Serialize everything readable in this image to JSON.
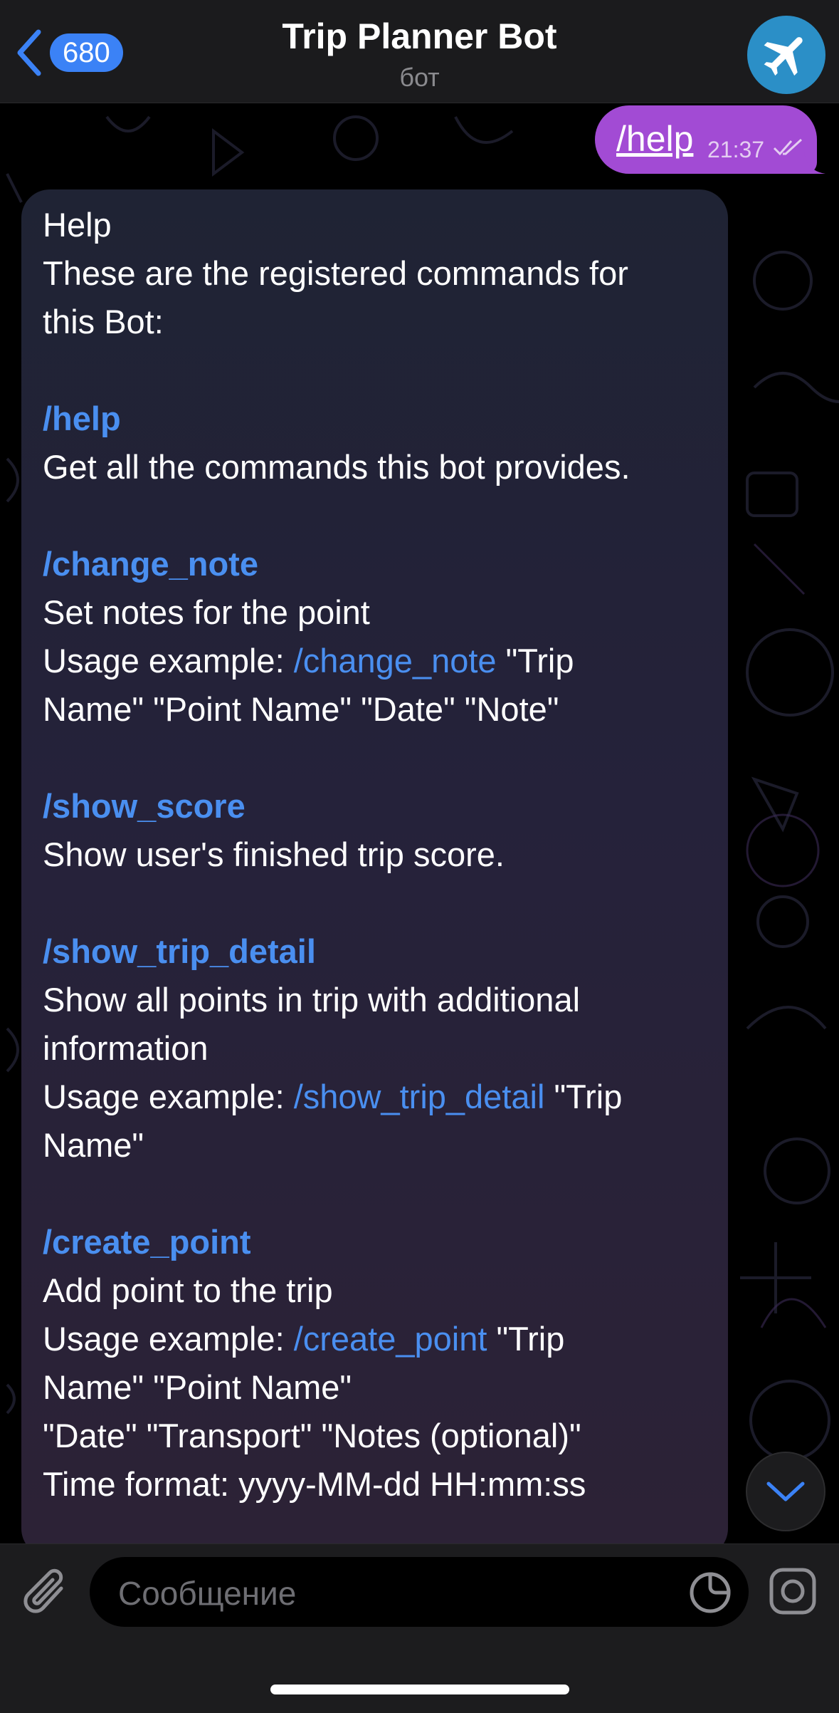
{
  "header": {
    "back_count": "680",
    "title": "Trip Planner Bot",
    "subtitle": "бот"
  },
  "outgoing": {
    "text": "/help",
    "time": "21:37",
    "accent": "#a24bd4"
  },
  "incoming": {
    "lines": {
      "l1": "Help",
      "l2": "These are the registered commands for",
      "l3": "this Bot:",
      "c1": "/help",
      "c1d": "Get all the commands this bot provides.",
      "c2": "/change_note",
      "c2d": "Set notes for the point",
      "c2u_prefix": "Usage example: ",
      "c2u_link": "/change_note",
      "c2u_suffix": " \"Trip",
      "c2u2": "Name\" \"Point Name\" \"Date\" \"Note\"",
      "c3": "/show_score",
      "c3d": "Show user's finished trip score.",
      "c4": "/show_trip_detail",
      "c4d1": "Show all points in trip with additional",
      "c4d2": "information",
      "c4u_prefix": "Usage example: ",
      "c4u_link": "/show_trip_detail",
      "c4u_suffix": " \"Trip",
      "c4u2": "Name\"",
      "c5": "/create_point",
      "c5d": "Add point to the trip",
      "c5u_prefix": "Usage example: ",
      "c5u_link": "/create_point",
      "c5u_suffix": " \"Trip",
      "c5u2": "Name\" \"Point Name\"",
      "c5u3": "\"Date\" \"Transport\" \"Notes (optional)\"",
      "c5u4": "Time format: yyyy-MM-dd HH:mm:ss"
    },
    "link_color": "#4a8ff0"
  },
  "composer": {
    "placeholder": "Сообщение"
  },
  "icons": {
    "back": "chevron-left-icon",
    "avatar": "airplane-icon",
    "read_status": "double-check-icon",
    "scroll": "chevron-down-icon",
    "attach": "paperclip-icon",
    "sticker": "sticker-icon",
    "camera": "instagram-camera-icon"
  }
}
